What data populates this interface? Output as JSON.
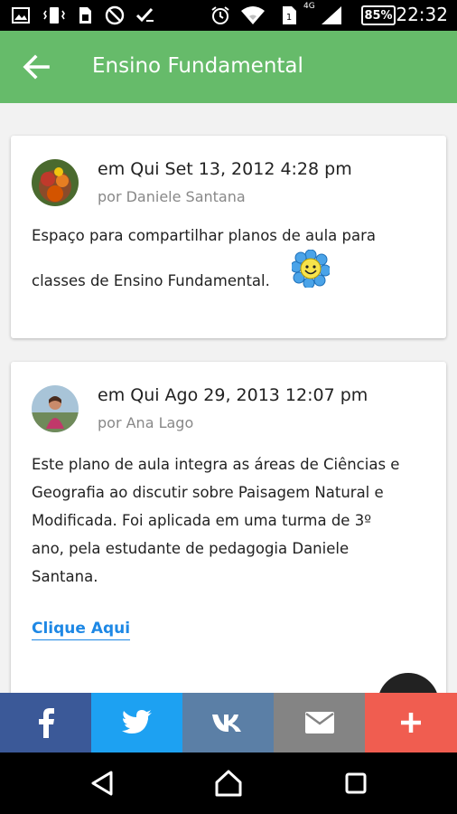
{
  "status_bar": {
    "time": "22:32",
    "battery": "85%",
    "network": "4G",
    "icons": [
      "image-icon",
      "vibrate-icon",
      "sim-icon",
      "no-disturb-icon",
      "checklist-icon",
      "alarm-icon",
      "wifi-icon",
      "sim1-icon",
      "signal-icon"
    ]
  },
  "app_bar": {
    "title": "Ensino Fundamental",
    "back_icon": "arrow-back-icon",
    "color": "#66bb6a"
  },
  "posts": [
    {
      "date": "em Qui Set 13, 2012 4:28 pm",
      "author": "por Daniele Santana",
      "body_lines": [
        "Espaço para compartilhar planos de aula para",
        "classes de Ensino Fundamental."
      ],
      "emoji": "smiling-flower-icon"
    },
    {
      "date": "em Qui Ago 29, 2013 12:07 pm",
      "author": "por Ana Lago",
      "body_lines": [
        "Este plano de aula integra as áreas de Ciências e",
        "Geografia ao discutir sobre Paisagem Natural e",
        "Modificada. Foi aplicada em uma turma de 3º",
        "ano, pela estudante de pedagogia Daniele",
        "Santana."
      ],
      "link": "Clique Aqui"
    }
  ],
  "share_bar": [
    {
      "name": "facebook",
      "icon": "facebook-icon",
      "color": "#3b5998"
    },
    {
      "name": "twitter",
      "icon": "twitter-icon",
      "color": "#1da1f2"
    },
    {
      "name": "vk",
      "icon": "vk-icon",
      "color": "#5b7fa6"
    },
    {
      "name": "email",
      "icon": "mail-icon",
      "color": "#848484"
    },
    {
      "name": "more",
      "icon": "plus-icon",
      "color": "#f05d50"
    }
  ],
  "nav_bar": [
    "back-triangle-icon",
    "home-icon",
    "recents-icon"
  ]
}
